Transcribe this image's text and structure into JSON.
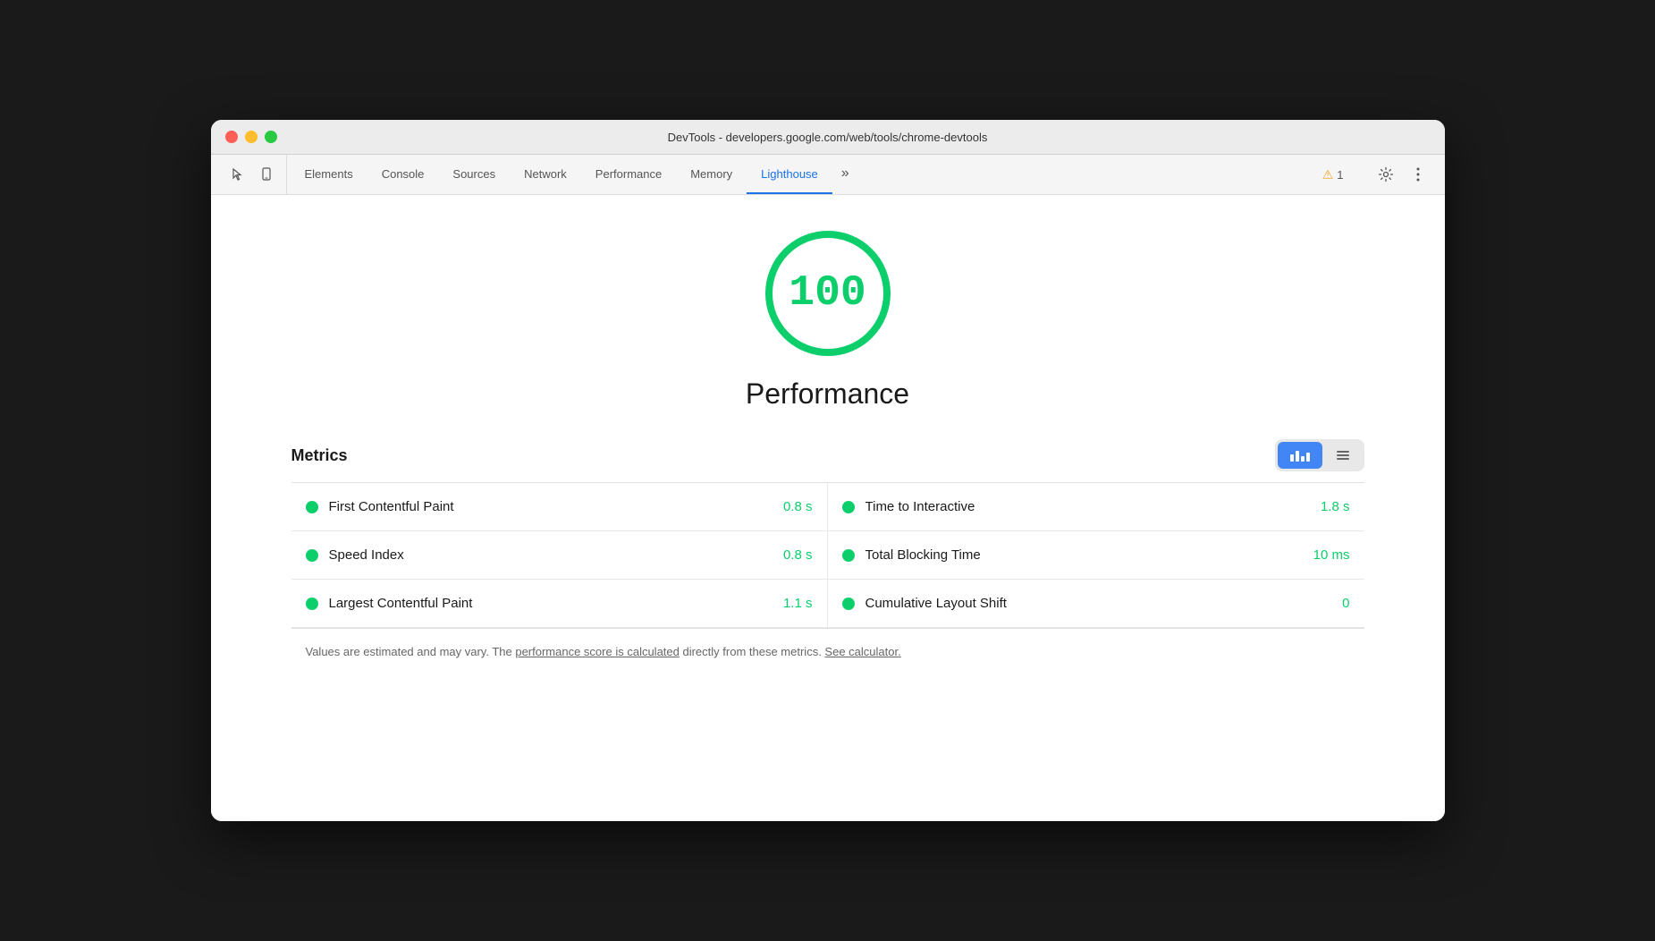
{
  "window": {
    "title": "DevTools - developers.google.com/web/tools/chrome-devtools"
  },
  "tabs": [
    {
      "id": "elements",
      "label": "Elements",
      "active": false
    },
    {
      "id": "console",
      "label": "Console",
      "active": false
    },
    {
      "id": "sources",
      "label": "Sources",
      "active": false
    },
    {
      "id": "network",
      "label": "Network",
      "active": false
    },
    {
      "id": "performance",
      "label": "Performance",
      "active": false
    },
    {
      "id": "memory",
      "label": "Memory",
      "active": false
    },
    {
      "id": "lighthouse",
      "label": "Lighthouse",
      "active": true
    }
  ],
  "toolbar": {
    "more_label": "»",
    "warning_count": "1",
    "settings_label": "⚙",
    "more_options_label": "⋮"
  },
  "score": {
    "value": "100",
    "label": "Performance"
  },
  "metrics": {
    "title": "Metrics",
    "rows": [
      {
        "left_name": "First Contentful Paint",
        "left_value": "0.8 s",
        "right_name": "Time to Interactive",
        "right_value": "1.8 s"
      },
      {
        "left_name": "Speed Index",
        "left_value": "0.8 s",
        "right_name": "Total Blocking Time",
        "right_value": "10 ms"
      },
      {
        "left_name": "Largest Contentful Paint",
        "left_value": "1.1 s",
        "right_name": "Cumulative Layout Shift",
        "right_value": "0"
      }
    ]
  },
  "footer": {
    "text_before": "Values are estimated and may vary. The ",
    "link1_text": "performance score is calculated",
    "text_middle": " directly from these metrics. ",
    "link2_text": "See calculator.",
    "text_after": ""
  },
  "colors": {
    "green": "#0cce6b",
    "blue": "#4285f4",
    "active_tab": "#1a73e8"
  }
}
